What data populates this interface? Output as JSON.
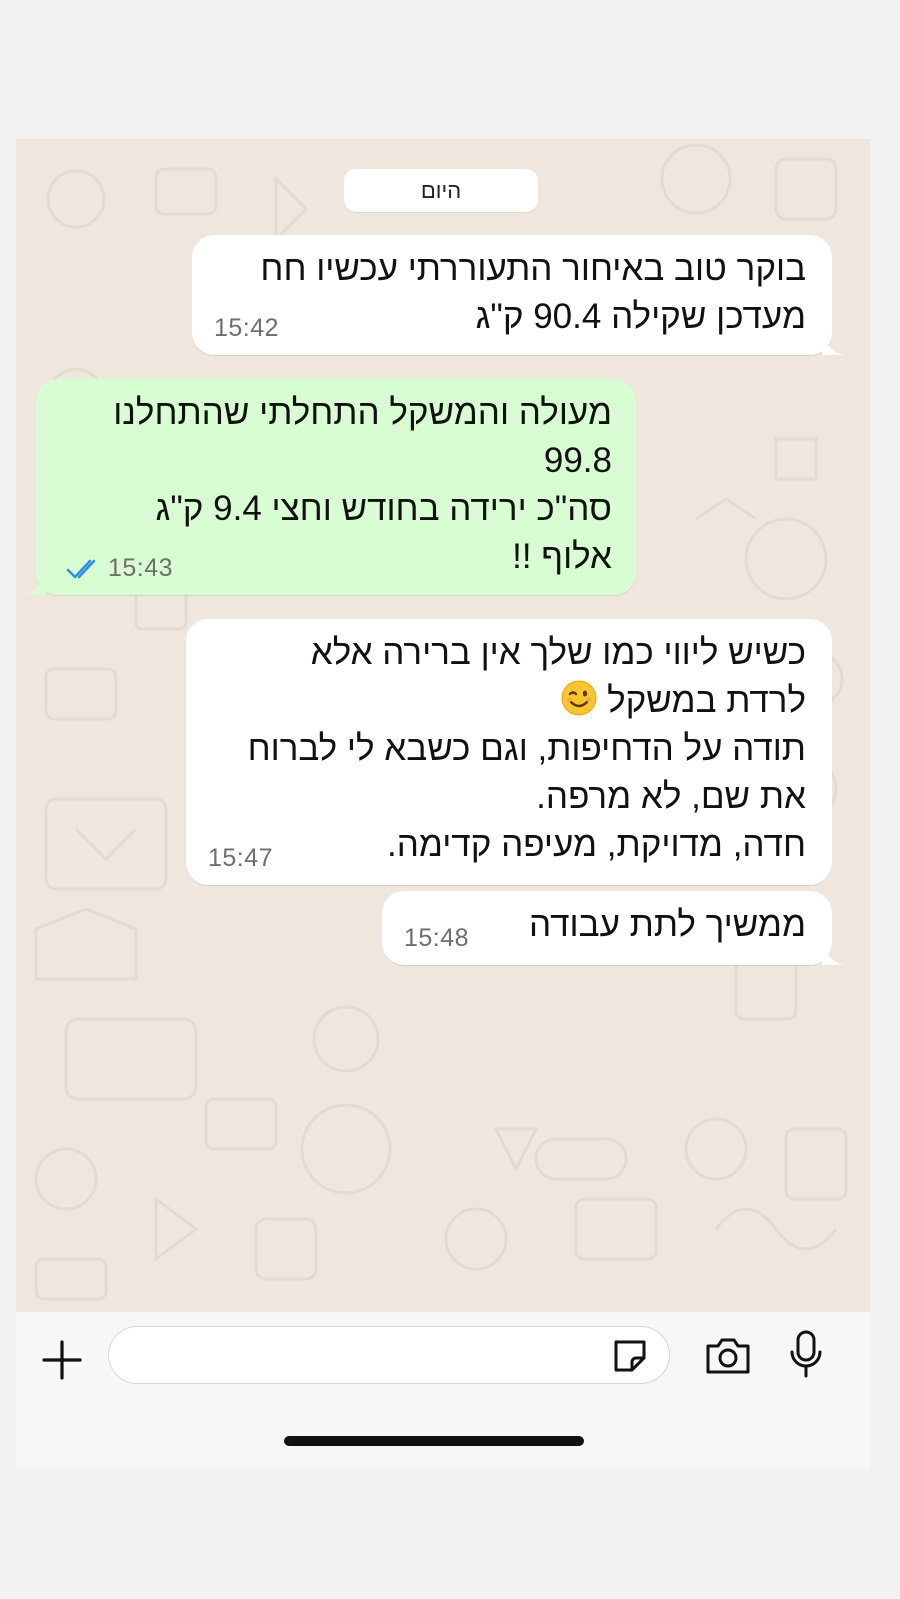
{
  "chat": {
    "date_label": "היום",
    "messages": [
      {
        "direction": "incoming",
        "text": "בוקר טוב באיחור התעוררתי עכשיו חח\nמעדכן שקילה 90.4 ק\"ג",
        "time": "15:42"
      },
      {
        "direction": "outgoing",
        "text": "מעולה והמשקל התחלתי שהתחלנו\n99.8\nסה\"כ ירידה בחודש וחצי 9.4 ק\"ג\nאלוף !!",
        "time": "15:43",
        "read_status": "read"
      },
      {
        "direction": "incoming",
        "text_lines": [
          "כשיש ליווי כמו שלך אין ברירה אלא",
          "לרדת במשקל",
          "תודה על הדחיפות, וגם כשבא לי לברוח",
          "את שם, לא מרפה.",
          "חדה, מדויקת, מעיפה קדימה."
        ],
        "emoji": "winking-face",
        "time": "15:47"
      },
      {
        "direction": "incoming",
        "text": "ממשיך לתת עבודה",
        "time": "15:48"
      }
    ]
  },
  "composer": {
    "input_value": "",
    "icons": {
      "attach": "plus-icon",
      "sticker": "sticker-icon",
      "camera": "camera-icon",
      "mic": "microphone-icon"
    }
  },
  "colors": {
    "wallpaper": "#efe7dd",
    "incoming_bubble": "#ffffff",
    "outgoing_bubble": "#d9fdd3",
    "read_ticks": "#2f8fe6"
  }
}
